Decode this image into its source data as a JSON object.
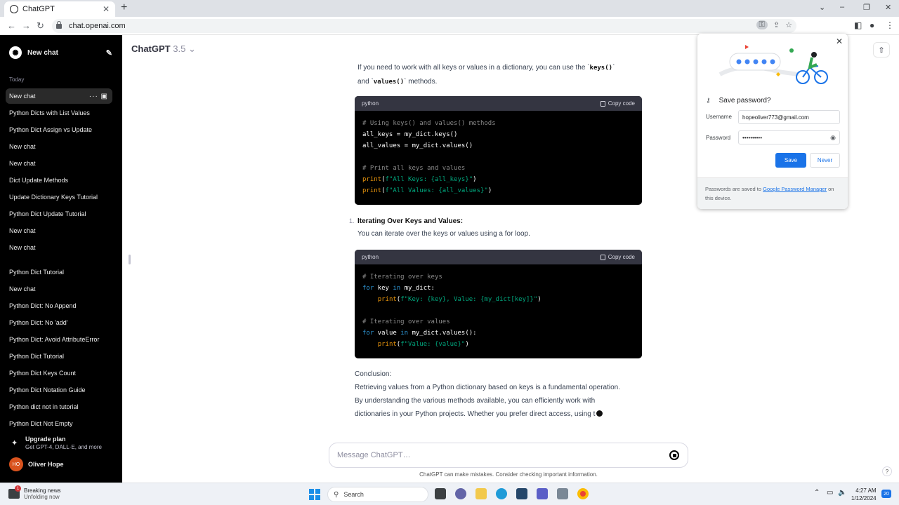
{
  "browser": {
    "tab_title": "ChatGPT",
    "tab_close": "✕",
    "new_tab": "+",
    "url": "chat.openai.com",
    "window_controls": [
      "⌄",
      "–",
      "❐",
      "✕"
    ]
  },
  "sidebar": {
    "new_chat": "New chat",
    "section_today": "Today",
    "items": [
      "New chat",
      "Python Dicts with List Values",
      "Python Dict Assign vs Update",
      "New chat",
      "New chat",
      "Dict Update Methods",
      "Update Dictionary Keys Tutorial",
      "Python Dict Update Tutorial",
      "New chat",
      "New chat",
      "Python Dict Tutorial",
      "New chat",
      "Python Dict: No Append",
      "Python Dict: No 'add'",
      "Python Dict: Avoid AttributeError",
      "Python Dict Tutorial",
      "Python Dict Keys Count",
      "Python Dict Notation Guide",
      "Python dict not in tutorial",
      "Python Dict Not Empty"
    ],
    "upgrade_title": "Upgrade plan",
    "upgrade_sub": "Get GPT-4, DALL·E, and more",
    "user_initials": "HO",
    "user_name": "Oliver Hope"
  },
  "header": {
    "model": "ChatGPT",
    "version": "3.5"
  },
  "content": {
    "intro_a": "If you need to work with all keys or values in a dictionary, you can use the `",
    "intro_code1": "keys()",
    "intro_b": "`",
    "intro_c": "and `",
    "intro_code2": "values()",
    "intro_d": "` methods.",
    "code1": {
      "lang": "python",
      "copy": "Copy code",
      "lines": {
        "l1": "# Using keys() and values() methods",
        "l2": "all_keys = my_dict.keys()",
        "l3": "all_values = my_dict.values()",
        "l5": "# Print all keys and values",
        "l6_fn": "print",
        "l6_str": "f\"All Keys: {all_keys}\"",
        "l7_fn": "print",
        "l7_str": "f\"All Values: {all_values}\""
      }
    },
    "list_num": "1.",
    "list_title": "Iterating Over Keys and Values:",
    "list_text": "You can iterate over the keys or values using a for loop.",
    "code2": {
      "lang": "python",
      "copy": "Copy code",
      "lines": {
        "l1": "# Iterating over keys",
        "l2_kw": "for",
        "l2_a": " key ",
        "l2_kw2": "in",
        "l2_b": " my_dict:",
        "l3_fn": "print",
        "l3_str": "f\"Key: {key}, Value: {my_dict[key]}\"",
        "l5": "# Iterating over values",
        "l6_kw": "for",
        "l6_a": " value ",
        "l6_kw2": "in",
        "l6_b": " my_dict.values():",
        "l7_fn": "print",
        "l7_str": "f\"Value: {value}\""
      }
    },
    "conclusion_label": "Conclusion:",
    "conclusion_1": "Retrieving values from a Python dictionary based on keys is a fundamental operation.",
    "conclusion_2": "By understanding the various methods available, you can efficiently work with",
    "conclusion_3": "dictionaries in your Python projects. Whether you prefer direct access, using t"
  },
  "composer": {
    "placeholder": "Message ChatGPT…",
    "disclaimer": "ChatGPT can make mistakes. Consider checking important information.",
    "help": "?"
  },
  "password_popup": {
    "title": "Save password?",
    "username_label": "Username",
    "username_value": "hopeoliver773@gmail.com",
    "password_label": "Password",
    "password_value": "••••••••••",
    "save": "Save",
    "never": "Never",
    "footer_a": "Passwords are saved to ",
    "footer_link": "Google Password Manager",
    "footer_b": " on this device."
  },
  "taskbar": {
    "news_badge": "1",
    "news_title": "Breaking news",
    "news_sub": "Unfolding now",
    "search": "Search",
    "time": "4:27 AM",
    "date": "1/12/2024",
    "notif": "20"
  },
  "colors": {
    "sidebar_bg": "#000000",
    "accent": "#1a73e8",
    "code_bg": "#000000"
  }
}
